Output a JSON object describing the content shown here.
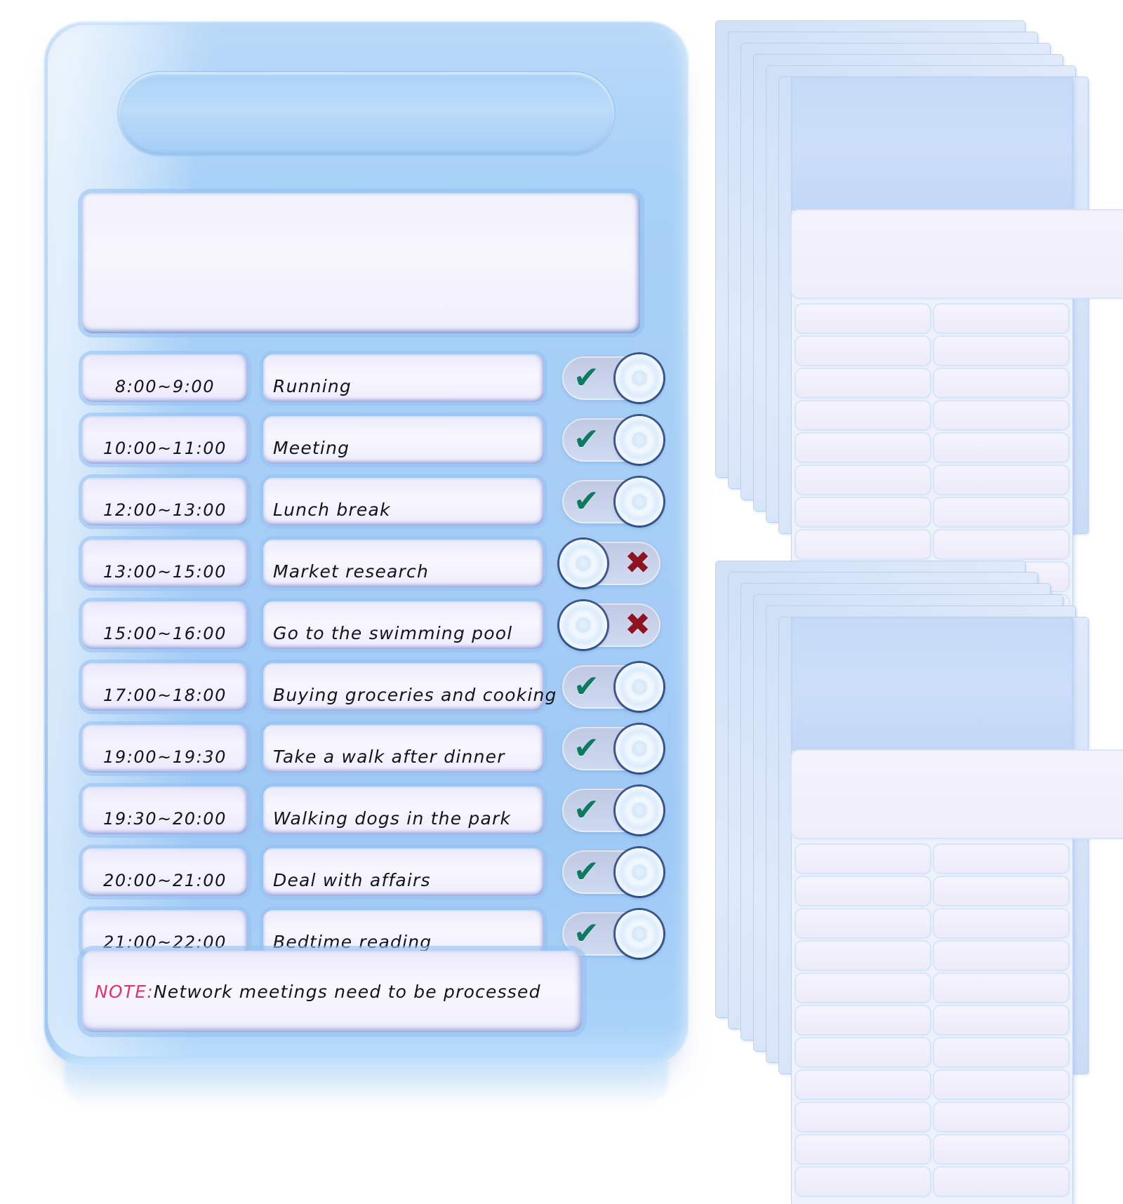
{
  "product": {
    "kind": "chore-chart-checklist-board",
    "board": {
      "title_text": "",
      "hanging_hole": "hanging-hole",
      "note": {
        "label": "NOTE:",
        "body": "Network meetings need to be processed"
      },
      "columns": [
        "time",
        "task",
        "status"
      ],
      "rows": [
        {
          "time": "8:00~9:00",
          "task": "Running",
          "status": "done",
          "mark": "✔"
        },
        {
          "time": "10:00~11:00",
          "task": "Meeting",
          "status": "done",
          "mark": "✔"
        },
        {
          "time": "12:00~13:00",
          "task": "Lunch break",
          "status": "done",
          "mark": "✔"
        },
        {
          "time": "13:00~15:00",
          "task": "Market research",
          "status": "undone",
          "mark": "✖"
        },
        {
          "time": "15:00~16:00",
          "task": "Go to the swimming pool",
          "status": "undone",
          "mark": "✖"
        },
        {
          "time": "17:00~18:00",
          "task": "Buying groceries and cooking",
          "status": "done",
          "mark": "✔"
        },
        {
          "time": "19:00~19:30",
          "task": "Take a walk after dinner",
          "status": "done",
          "mark": "✔"
        },
        {
          "time": "19:30~20:00",
          "task": "Walking dogs in the park",
          "status": "done",
          "mark": "✔"
        },
        {
          "time": "20:00~21:00",
          "task": "Deal with affairs",
          "status": "done",
          "mark": "✔"
        },
        {
          "time": "21:00~22:00",
          "task": "Bedtime reading",
          "status": "done",
          "mark": "✔"
        }
      ]
    },
    "label_sheets": {
      "stack_count": 2,
      "sheets_per_stack": 6,
      "grid_rows": 11,
      "grid_columns": 2,
      "header_band_text": "",
      "wide_label_text": "",
      "cell_text": ""
    },
    "colors": {
      "board_blue": "#a5cdf6",
      "window_white": "#f2f1fc",
      "frame_blue": "#96c1f2",
      "check_green": "#0d7a62",
      "cross_red": "#8d1322",
      "note_red": "#e1356b",
      "ink_black": "#141418",
      "sheet_header_blue": "#c6daf8",
      "background": "#ffffff"
    }
  }
}
